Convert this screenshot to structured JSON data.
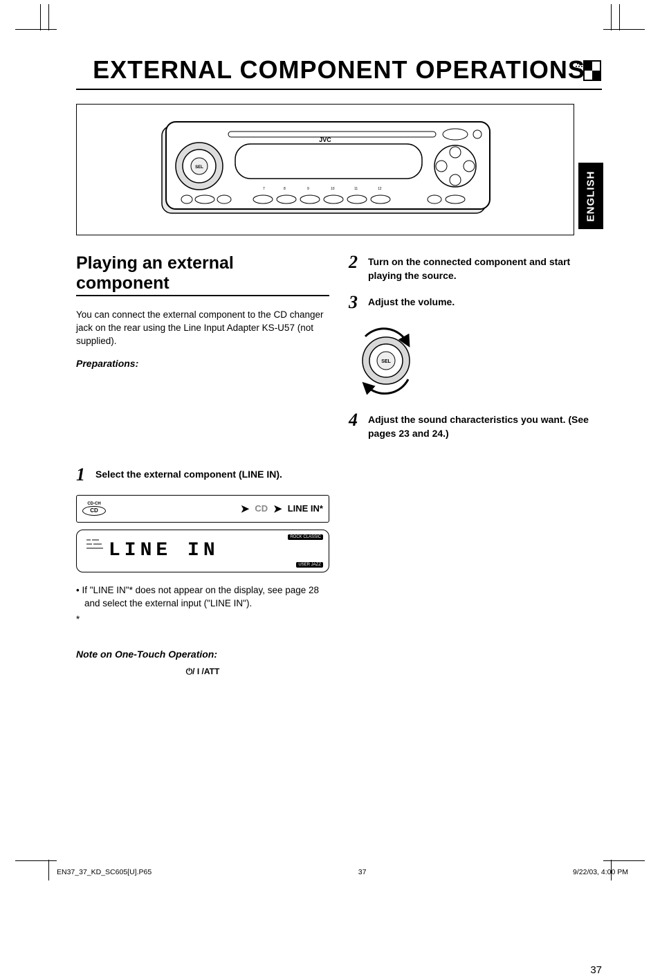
{
  "title": "EXTERNAL COMPONENT OPERATIONS",
  "language_tab": "ENGLISH",
  "device_brand": "JVC",
  "section": {
    "heading": "Playing an external component",
    "intro": "You can connect the external component to the CD changer jack on the rear using the Line Input Adapter KS-U57 (not supplied).",
    "prep_label": "Preparations:"
  },
  "left": {
    "step1_num": "1",
    "step1_text": "Select the external component (LINE IN).",
    "flow": {
      "btn_top": "CD-CH",
      "btn": "CD",
      "cd": "CD",
      "line_in": "LINE IN*"
    },
    "display_text": "LINE  IN",
    "display_badges_top": "ROCK CLASSIC",
    "display_badges_bot": "USER  JAZZ",
    "bullet1": "• If \"LINE IN\"* does not appear on the display, see page 28 and select the external input (\"LINE IN\").",
    "asterisk": "*",
    "note_label": "Note on One-Touch Operation:",
    "att_symbol": "⏻/ I /ATT"
  },
  "right": {
    "step2_num": "2",
    "step2_text": "Turn on the connected component and start playing the source.",
    "step3_num": "3",
    "step3_text": "Adjust the volume.",
    "knob_label": "SEL",
    "step4_num": "4",
    "step4_text": "Adjust the sound characteristics you want. (See pages 23 and 24.)"
  },
  "page_number": "37",
  "footer": {
    "file": "EN37_37_KD_SC605[U].P65",
    "page": "37",
    "timestamp": "9/22/03, 4:00 PM"
  }
}
